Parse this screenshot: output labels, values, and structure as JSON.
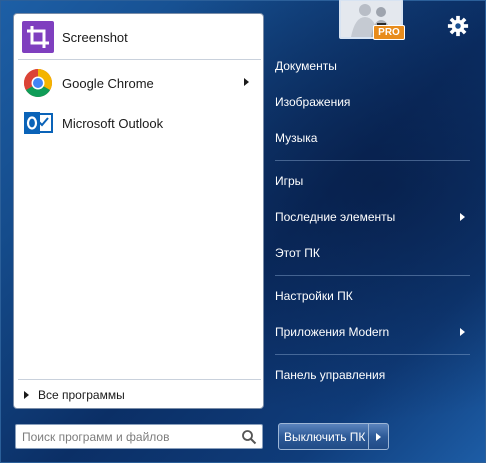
{
  "colors": {
    "accent": "#1d5fa6",
    "screenshot_icon": "#7f3fbf",
    "outlook_icon": "#0a63b8",
    "pro_badge": "#e88c1c"
  },
  "pinned": [
    {
      "label": "Screenshot",
      "icon": "crop-icon",
      "has_arrow": false
    },
    {
      "label": "Google Chrome",
      "icon": "chrome-icon",
      "has_arrow": true
    },
    {
      "label": "Microsoft Outlook",
      "icon": "outlook-icon",
      "has_arrow": false
    }
  ],
  "all_programs": {
    "label": "Все программы"
  },
  "search": {
    "placeholder": "Поиск программ и файлов"
  },
  "user": {
    "badge": "PRO"
  },
  "right_menu": [
    {
      "label": "Документы",
      "has_arrow": false
    },
    {
      "label": "Изображения",
      "has_arrow": false
    },
    {
      "label": "Музыка",
      "has_arrow": false
    },
    {
      "label": "Игры",
      "has_arrow": false
    },
    {
      "label": "Последние элементы",
      "has_arrow": true
    },
    {
      "label": "Этот ПК",
      "has_arrow": false
    },
    {
      "label": "Настройки ПК",
      "has_arrow": false
    },
    {
      "label": "Приложения Modern",
      "has_arrow": true
    },
    {
      "label": "Панель управления",
      "has_arrow": false
    }
  ],
  "shutdown": {
    "label": "Выключить ПК"
  }
}
